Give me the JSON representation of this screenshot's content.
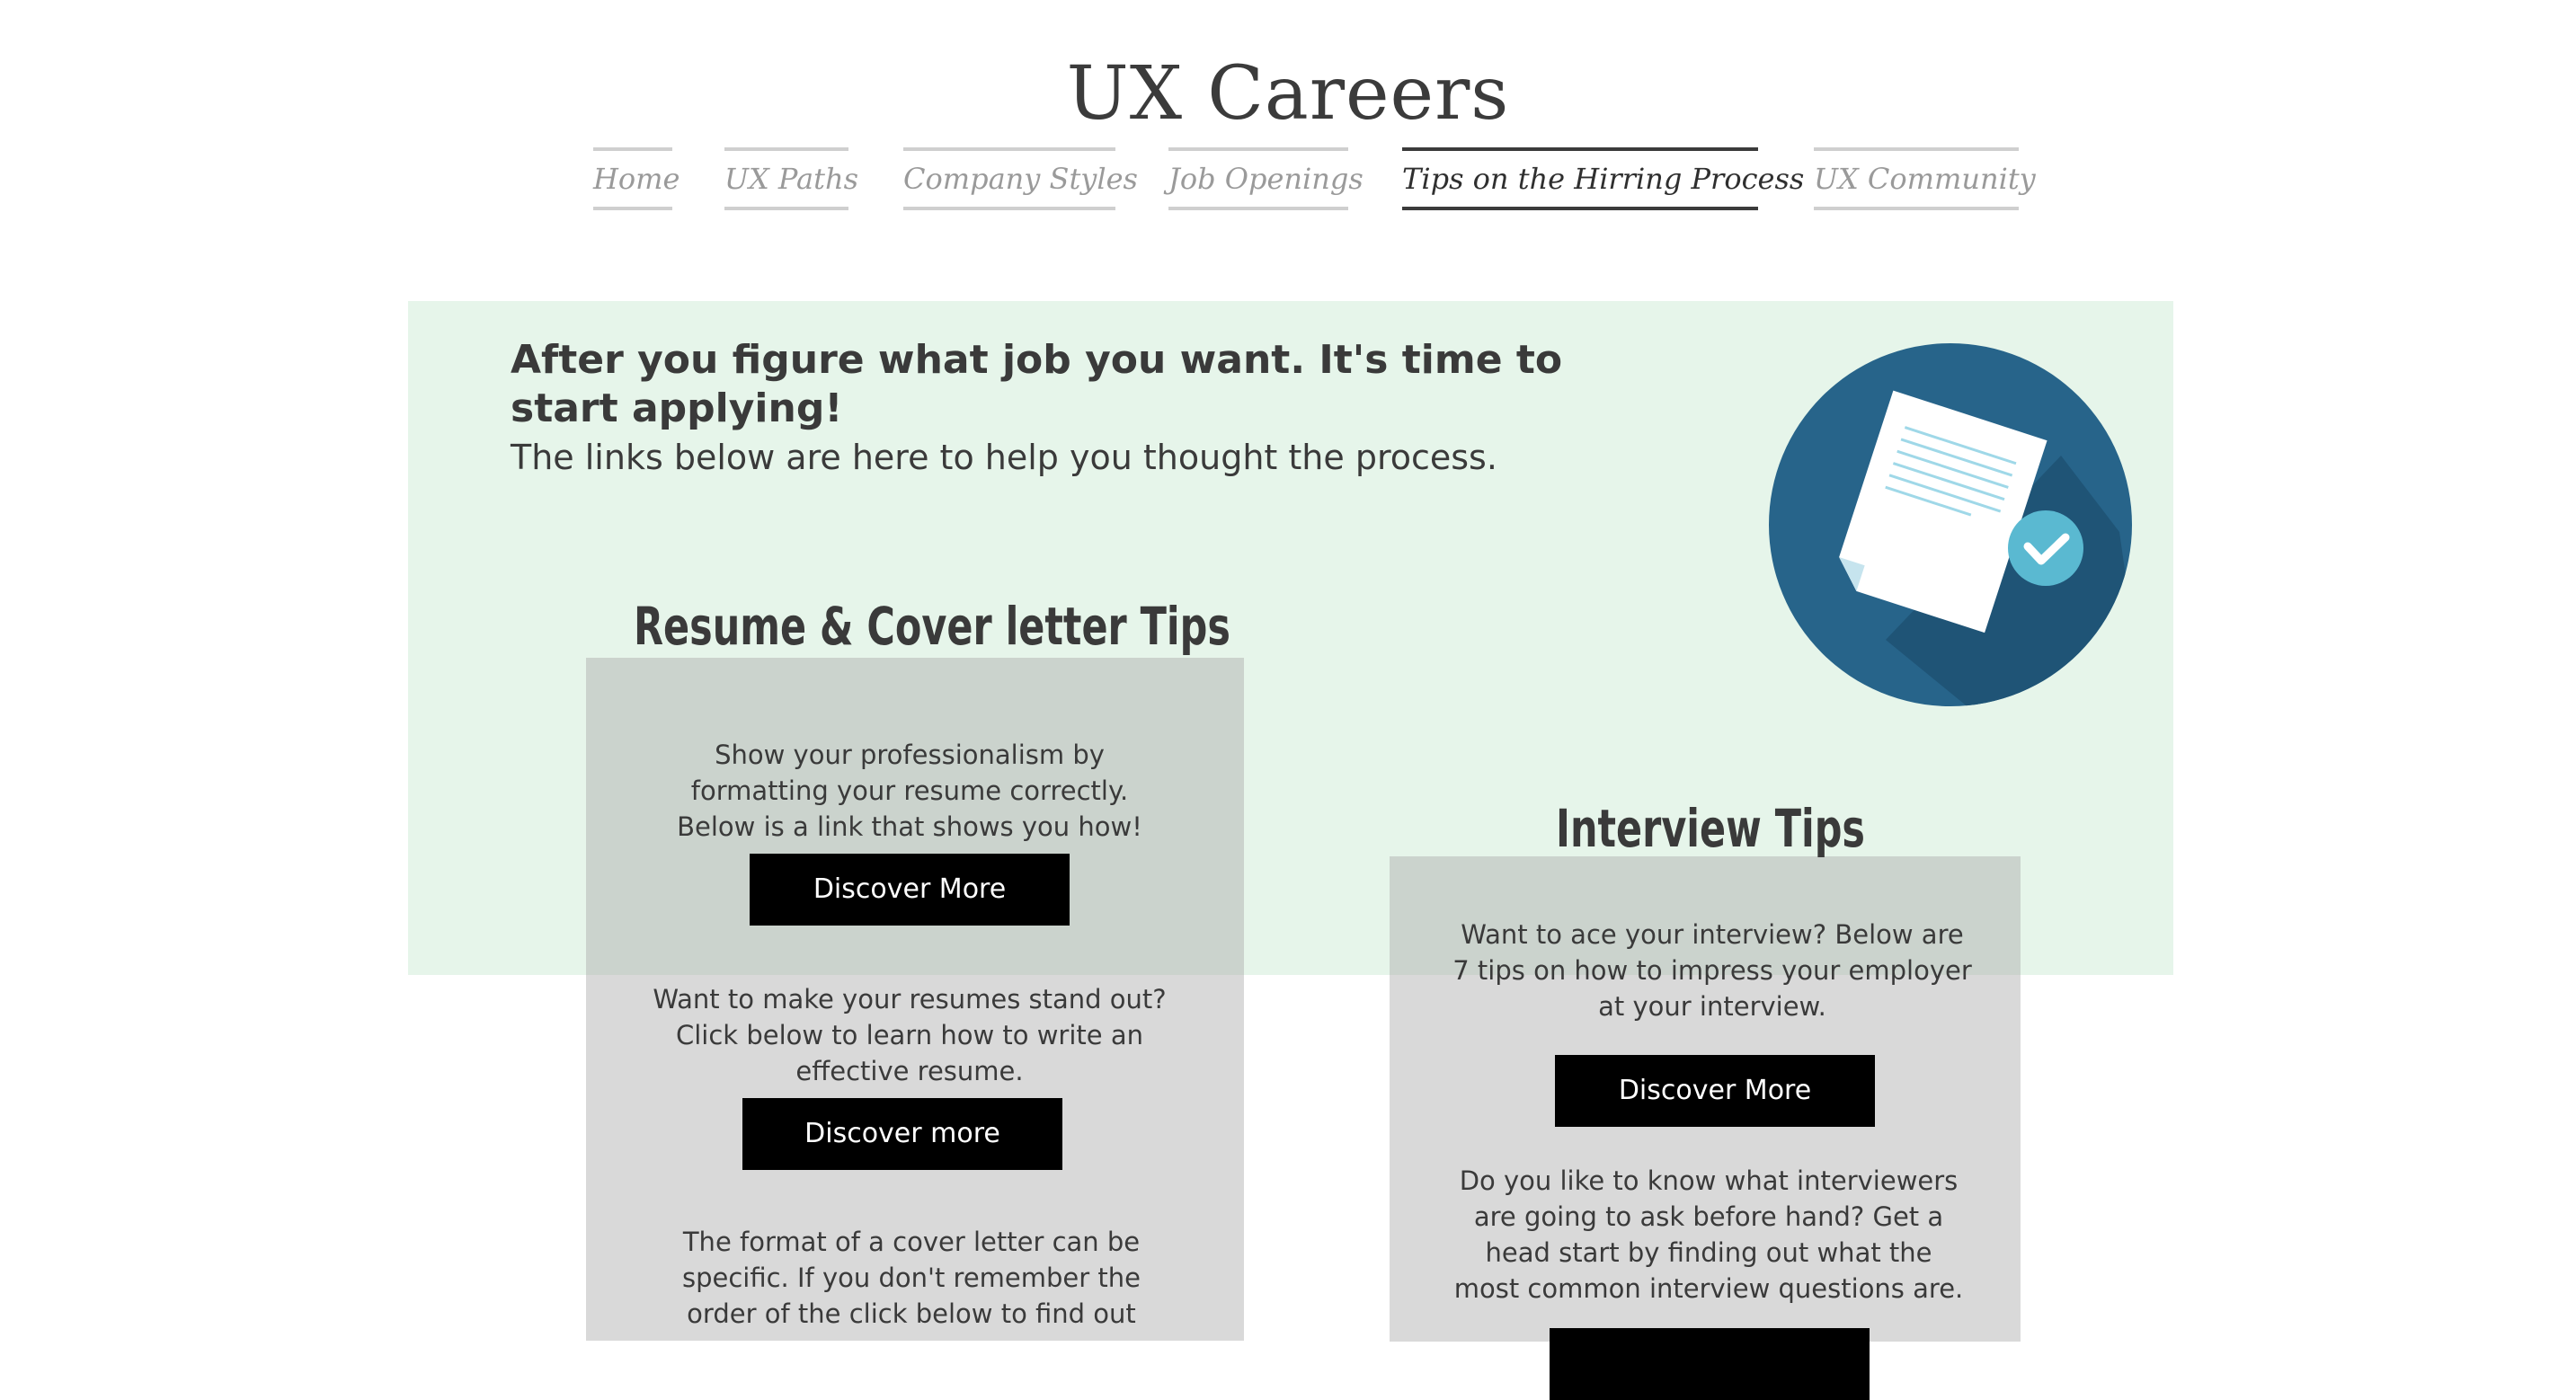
{
  "site": {
    "title": "UX Careers"
  },
  "nav": {
    "items": [
      {
        "label": "Home"
      },
      {
        "label": "UX Paths"
      },
      {
        "label": "Company Styles"
      },
      {
        "label": "Job Openings"
      },
      {
        "label": "Tips on the Hirring Process",
        "active": true
      },
      {
        "label": "UX Community"
      }
    ]
  },
  "hero": {
    "heading": "After you figure what job you want. It's time to start applying!",
    "subheading": "The links below are here to help you thought the process.",
    "illustration": "document-check-icon"
  },
  "resume": {
    "title": "Resume & Cover letter Tips",
    "block1_text": "Show your professionalism by formatting your resume correctly. Below is a link that shows you how!",
    "block1_button": "Discover More",
    "block2_text": "Want to make your resumes stand out? Click below to learn how to write an effective resume.",
    "block2_button": "Discover more",
    "block3_text": "The format of a cover letter can be specific. If you don't remember the order of the click below to find out"
  },
  "interview": {
    "title": "Interview Tips",
    "block1_text": "Want to ace your interview? Below are 7 tips on how to impress your employer at your interview.",
    "block1_button": "Discover More",
    "block2_text": "Do you like to know what interviewers are going to ask before hand? Get a head start by finding out what the most common interview questions are."
  },
  "colors": {
    "hero_background": "#e6f5ea",
    "card_background": "#d8d8d8",
    "button_background": "#000000",
    "icon_circle": "#27648a",
    "check_badge": "#5ab9d1"
  }
}
